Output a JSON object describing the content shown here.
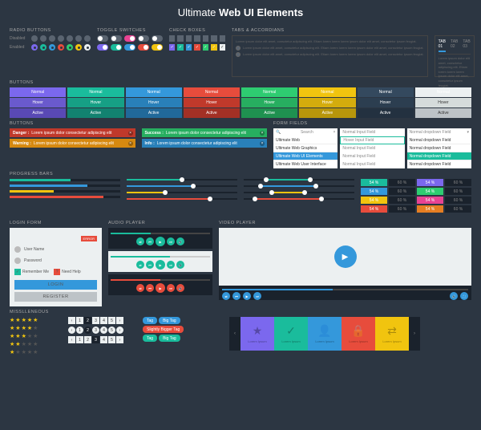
{
  "title_pre": "Ultimate ",
  "title_b": "Web UI Elements",
  "sections": {
    "radio": "RADIO BUTTONS",
    "toggle": "TOGGLE SWITCHES",
    "check": "CHECK BOXES",
    "tabs": "TABS & ACCORDIANS",
    "buttons": "BUTTONS",
    "buttons2": "BUTTONS",
    "progress": "PROGRESS BARS",
    "form": "FORM FIELDS",
    "login": "LOGIN FORM",
    "audio": "AUDIO PLAYER",
    "video": "VIDEO PLAYER",
    "misc": "MISSLLENEOUS"
  },
  "ctrl_labels": {
    "disabled": "Disabled",
    "enabled": "Enabled"
  },
  "tabs": {
    "t1": "TAB 01",
    "t2": "TAB 02",
    "t3": "TAB 03",
    "lorem": "Lorem ipsum dolor elit amet, consctetur adipiscing elit. Etiam lorem lorem lorem ipsum dolor elit amet, consctetur ipsum feugiat."
  },
  "btn_states": {
    "normal": "Normal",
    "hover": "Hover",
    "active": "Active"
  },
  "alerts": {
    "danger": "Danger :",
    "warning": "Warning :",
    "success": "Success :",
    "info": "Info :",
    "msg": "Lorem ipsum dolor consectetur adipiscing elit"
  },
  "form": {
    "search": "Search",
    "normal_input": "Normal Input Field",
    "hover_input": "Hover Input Field",
    "normal_dd": "Normal dropdown Field",
    "opts": [
      "Ultimate Web",
      "Ultimate Web Graphics",
      "Ultimate Web UI Elements",
      "Ultimate Web User Interface"
    ]
  },
  "pct": {
    "v54": "54 %",
    "v60": "60 %"
  },
  "login": {
    "user": "User Name",
    "pass": "Password",
    "remember": "Remember Me",
    "help": "Need Help",
    "login_btn": "LOGIN",
    "register": "REGISTER",
    "err": "ERROR"
  },
  "tags": {
    "tag": "Tag",
    "big": "Big Tag",
    "bigger": "Slightly Bigger Tag"
  },
  "tile_txt": "Lorem Ipsum",
  "pager": [
    "1",
    "2",
    "3",
    "4",
    "5"
  ]
}
